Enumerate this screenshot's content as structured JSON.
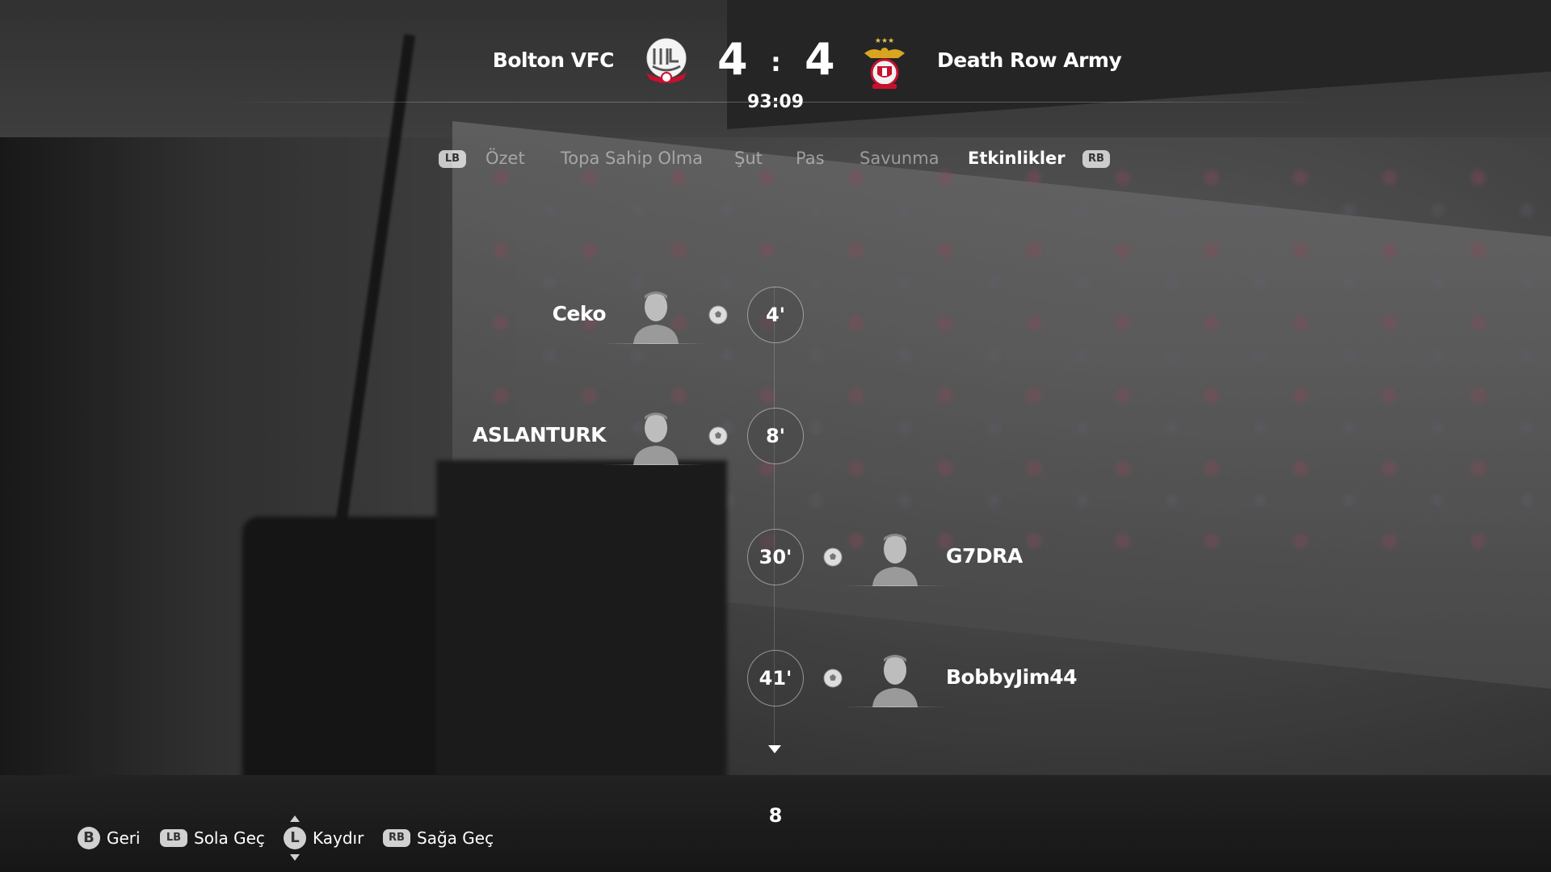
{
  "match": {
    "home_team": "Bolton VFC",
    "away_team": "Death Row Army",
    "home_score": "4",
    "separator": ":",
    "away_score": "4",
    "clock": "93:09",
    "home_crest_icon": "bolton-crest-icon",
    "away_crest_icon": "benfica-crest-icon"
  },
  "tabs": {
    "prev_button": "LB",
    "next_button": "RB",
    "items": [
      {
        "label": "Özet",
        "active": false
      },
      {
        "label": "Topa Sahip Olma",
        "active": false
      },
      {
        "label": "Şut",
        "active": false
      },
      {
        "label": "Pas",
        "active": false
      },
      {
        "label": "Savunma",
        "active": false
      },
      {
        "label": "Etkinlikler",
        "active": true
      }
    ]
  },
  "events": [
    {
      "minute": "4'",
      "player": "Ceko",
      "side": "home",
      "type": "goal",
      "icon": "soccer-ball-icon"
    },
    {
      "minute": "8'",
      "player": "ASLANTURK",
      "side": "home",
      "type": "goal",
      "icon": "soccer-ball-icon"
    },
    {
      "minute": "30'",
      "player": "G7DRA",
      "side": "away",
      "type": "goal",
      "icon": "soccer-ball-icon"
    },
    {
      "minute": "41'",
      "player": "BobbyJim44",
      "side": "away",
      "type": "goal",
      "icon": "soccer-ball-icon"
    }
  ],
  "pagination": {
    "count": "8"
  },
  "footer": {
    "back": {
      "button": "B",
      "label": "Geri"
    },
    "left": {
      "button": "LB",
      "label": "Sola Geç"
    },
    "scroll": {
      "button": "L",
      "label": "Kaydır"
    },
    "right": {
      "button": "RB",
      "label": "Sağa Geç"
    }
  },
  "colors": {
    "accent_text": "#ffffff",
    "muted_text": "#9a9a9a",
    "home_crest_red": "#c8102e"
  }
}
